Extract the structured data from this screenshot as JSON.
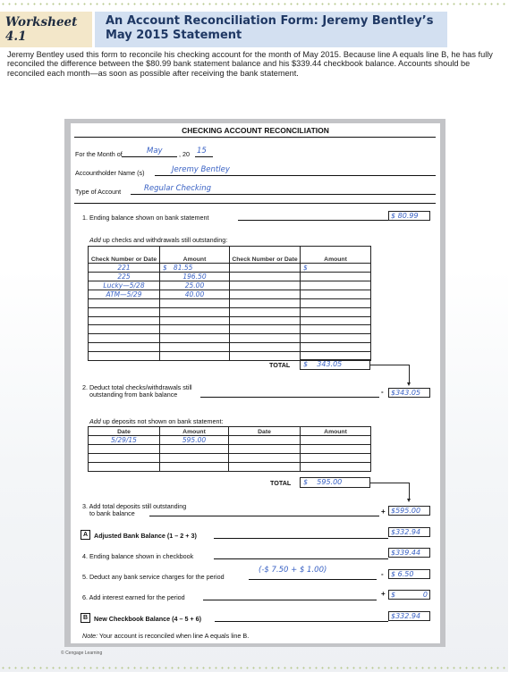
{
  "header": {
    "worksheet_label": "Worksheet 4.1",
    "title": "An Account Reconciliation Form: Jeremy Bentley’s May 2015 Statement",
    "intro": "Jeremy Bentley used this form to reconcile his checking account for the month of May 2015. Because line A equals line B, he has fully reconciled the difference between the $80.99 bank statement balance and his $339.44 checkbook balance. Accounts should be reconciled each month—as soon as possible after receiving the bank statement."
  },
  "form": {
    "title": "CHECKING ACCOUNT RECONCILIATION",
    "month_label": "For the Month of",
    "month_value": "May",
    "year_prefix": ", 20",
    "year_value": "15",
    "name_label": "Accountholder Name (s)",
    "name_value": "Jeremy Bentley",
    "type_label": "Type of Account",
    "type_value": "Regular Checking",
    "line1": {
      "label": "1. Ending balance shown on bank statement",
      "value": "$ 80.99"
    },
    "checks": {
      "caption_em": "Add",
      "caption": " up checks and withdrawals still outstanding:",
      "headers": [
        "Check Number or Date",
        "Amount",
        "Check Number or Date",
        "Amount"
      ],
      "rows": [
        [
          "221",
          "$   81.55",
          "",
          "$"
        ],
        [
          "225",
          "196.50",
          "",
          ""
        ],
        [
          "Lucky—5/28",
          "25.00",
          "",
          ""
        ],
        [
          "ATM—5/29",
          "40.00",
          "",
          ""
        ],
        [
          "",
          "",
          "",
          ""
        ],
        [
          "",
          "",
          "",
          ""
        ],
        [
          "",
          "",
          "",
          ""
        ],
        [
          "",
          "",
          "",
          ""
        ],
        [
          "",
          "",
          "",
          ""
        ],
        [
          "",
          "",
          "",
          ""
        ],
        [
          "",
          "",
          "",
          ""
        ]
      ],
      "total_label": "TOTAL",
      "total_value": "$    343.05"
    },
    "line2": {
      "label_1": "2. Deduct total checks/withdrawals still",
      "label_2": "outstanding from bank balance",
      "sign": "-",
      "value": "$343.05"
    },
    "deposits": {
      "caption_em": "Add",
      "caption": " up deposits not shown on bank statement:",
      "headers": [
        "Date",
        "Amount",
        "Date",
        "Amount"
      ],
      "rows": [
        [
          "5/29/15",
          "595.00",
          "",
          ""
        ],
        [
          "",
          "",
          "",
          ""
        ],
        [
          "",
          "",
          "",
          ""
        ],
        [
          "",
          "",
          "",
          ""
        ]
      ],
      "total_label": "TOTAL",
      "total_value": "$    595.00"
    },
    "line3": {
      "label_1": "3. Add total deposits still outstanding",
      "label_2": "to bank balance",
      "sign": "+",
      "value": "$595.00"
    },
    "lineA": {
      "letter": "A",
      "label": "Adjusted Bank Balance (1 – 2 + 3)",
      "value": "$332.94"
    },
    "line4": {
      "label": "4.  Ending balance shown in checkbook",
      "value": "$339.44"
    },
    "line5": {
      "label": "5. Deduct any bank service charges for the period",
      "note": "(-$ 7.50 + $ 1.00)",
      "sign": "-",
      "value": "$    6.50"
    },
    "line6": {
      "label": "6. Add interest earned for the period",
      "sign": "+",
      "value_prefix": "$",
      "value": "0"
    },
    "lineB": {
      "letter": "B",
      "label": "New Checkbook Balance (4 – 5 + 6)",
      "value": "$332.94"
    },
    "note_em": "Note:",
    "note": " Your account is reconciled when line A equals line B."
  },
  "copyright": "© Cengage Learning"
}
